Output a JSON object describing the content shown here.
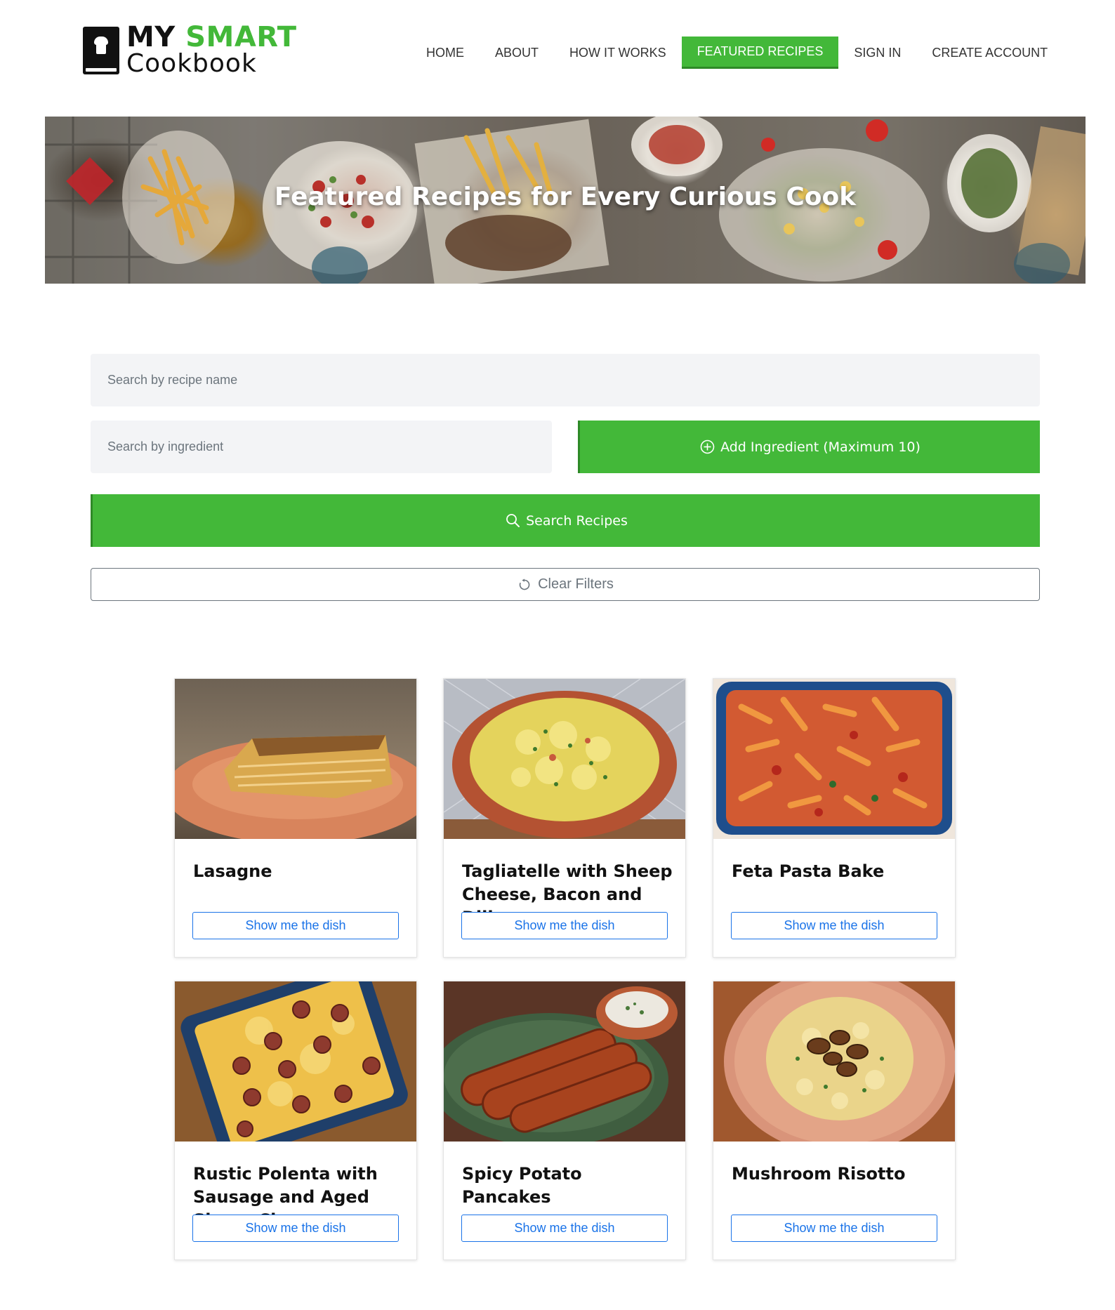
{
  "brand": {
    "word1": "MY",
    "word2": "SMART",
    "word3": "Cookbook"
  },
  "nav": [
    {
      "label": "HOME",
      "active": false
    },
    {
      "label": "ABOUT",
      "active": false
    },
    {
      "label": "HOW IT WORKS",
      "active": false
    },
    {
      "label": "FEATURED RECIPES",
      "active": true
    },
    {
      "label": "SIGN IN",
      "active": false
    },
    {
      "label": "CREATE ACCOUNT",
      "active": false
    }
  ],
  "banner": {
    "title": "Featured Recipes for Every Curious Cook"
  },
  "search": {
    "recipe_placeholder": "Search by recipe name",
    "ingredient_placeholder": "Search by ingredient",
    "add_ingredient_label": "Add Ingredient (Maximum 10)",
    "search_label": "Search Recipes",
    "clear_label": "Clear Filters"
  },
  "colors": {
    "accent": "#43b839",
    "link": "#1a73e8"
  },
  "recipes": [
    {
      "title": "Lasagne",
      "button": "Show me the dish"
    },
    {
      "title": "Tagliatelle with Sheep Cheese, Bacon and Dill",
      "button": "Show me the dish"
    },
    {
      "title": "Feta Pasta Bake",
      "button": "Show me the dish"
    },
    {
      "title": "Rustic Polenta with Sausage and Aged Sheep Cheese",
      "button": "Show me the dish"
    },
    {
      "title": "Spicy Potato Pancakes",
      "button": "Show me the dish"
    },
    {
      "title": "Mushroom Risotto",
      "button": "Show me the dish"
    }
  ]
}
